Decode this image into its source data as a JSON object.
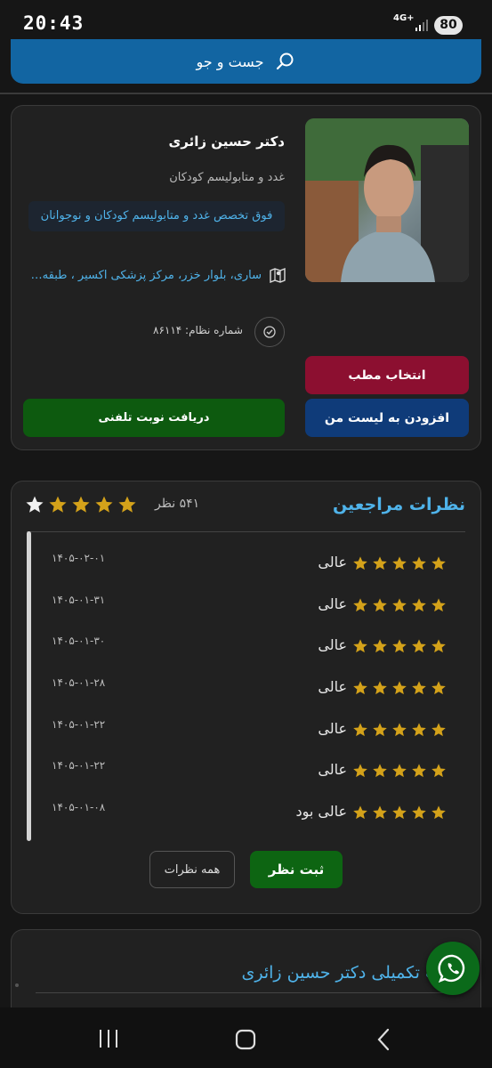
{
  "status_bar": {
    "time": "20:43",
    "network": "4G+",
    "battery": "80"
  },
  "search": {
    "label": "جست و جو",
    "icon": "search-icon"
  },
  "doctor": {
    "name": "دکتر حسین زائری",
    "specialty": "غدد و متابولیسم کودکان",
    "subspecialty": "فوق تخصص غدد و متابولیسم کودکان و نوجوانان",
    "address": "ساری، بلوار خزر، مرکز پزشکی اکسیر ، طبقه ۵ ،...",
    "registration": "شماره نظام: ۸۶۱۱۴",
    "buttons": {
      "select_office": "انتخاب مطب",
      "add_to_list": "افزودن به لیست من",
      "phone_booking": "دریافت نوبت تلفنی"
    }
  },
  "reviews": {
    "title": "نظرات مراجعین",
    "count": "۵۴۱ نظر",
    "average_stars_filled": 4,
    "average_stars_total": 5,
    "items": [
      {
        "label": "عالی",
        "date": "۱۴۰۵-۰۲-۰۱",
        "stars": 5
      },
      {
        "label": "عالی",
        "date": "۱۴۰۵-۰۱-۳۱",
        "stars": 5
      },
      {
        "label": "عالی",
        "date": "۱۴۰۵-۰۱-۳۰",
        "stars": 5
      },
      {
        "label": "عالی",
        "date": "۱۴۰۵-۰۱-۲۸",
        "stars": 5
      },
      {
        "label": "عالی",
        "date": "۱۴۰۵-۰۱-۲۲",
        "stars": 5
      },
      {
        "label": "عالی",
        "date": "۱۴۰۵-۰۱-۲۲",
        "stars": 5
      },
      {
        "label": "عالی بود",
        "date": "۱۴۰۵-۰۱-۰۸",
        "stars": 5
      }
    ],
    "submit_label": "ثبت نظر",
    "all_label": "همه نظرات"
  },
  "info": {
    "title": "عات تکمیلی دکتر حسین زائری"
  },
  "colors": {
    "accent_blue": "#4fb3ea",
    "search_bar": "#1265a2",
    "select_office": "#8c0f30",
    "add_to_list": "#0f3b79",
    "green_button": "#0d5a0f",
    "star_gold": "#d4a21a",
    "whatsapp": "#0b6a1a"
  }
}
